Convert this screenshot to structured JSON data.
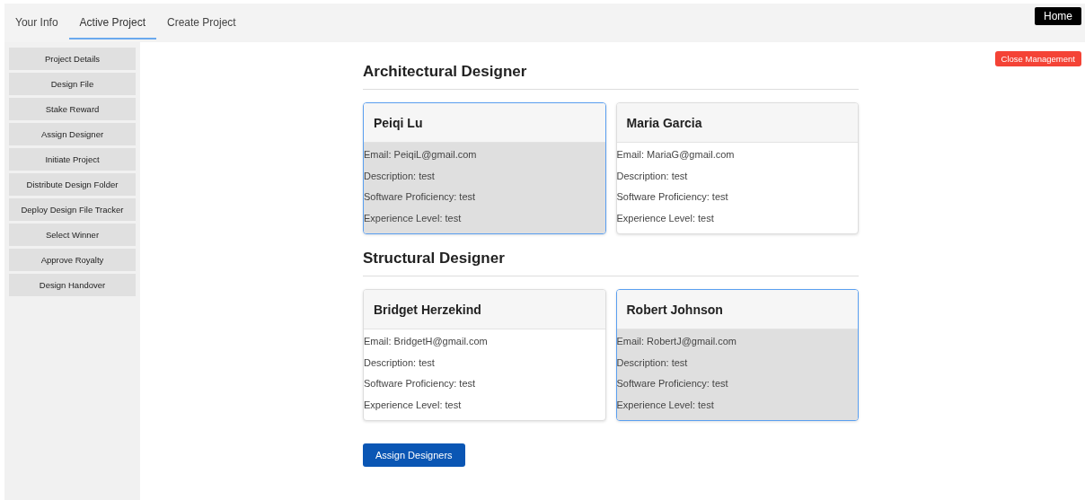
{
  "tabs": [
    {
      "label": "Your Info",
      "selected": false
    },
    {
      "label": "Active Project",
      "selected": true
    },
    {
      "label": "Create Project",
      "selected": false
    }
  ],
  "home_button": "Home",
  "sidebar": {
    "items": [
      "Project Details",
      "Design File",
      "Stake Reward",
      "Assign Designer",
      "Initiate Project",
      "Distribute Design Folder",
      "Deploy Design File Tracker",
      "Select Winner",
      "Approve Royalty",
      "Design Handover"
    ]
  },
  "close_button": "Close Management",
  "sections": [
    {
      "title": "Architectural Designer",
      "designers": [
        {
          "name": "Peiqi Lu",
          "selected": true,
          "details": [
            "Email: PeiqiL@gmail.com",
            "Description: test",
            "Software Proficiency: test",
            "Experience Level: test"
          ]
        },
        {
          "name": "Maria Garcia",
          "selected": false,
          "details": [
            "Email: MariaG@gmail.com",
            "Description: test",
            "Software Proficiency: test",
            "Experience Level: test"
          ]
        }
      ]
    },
    {
      "title": "Structural Designer",
      "designers": [
        {
          "name": "Bridget Herzekind",
          "selected": false,
          "details": [
            "Email: BridgetH@gmail.com",
            "Description: test",
            "Software Proficiency: test",
            "Experience Level: test"
          ]
        },
        {
          "name": "Robert Johnson",
          "selected": true,
          "details": [
            "Email: RobertJ@gmail.com",
            "Description: test",
            "Software Proficiency: test",
            "Experience Level: test"
          ]
        }
      ]
    }
  ],
  "submit_button": "Assign Designers"
}
